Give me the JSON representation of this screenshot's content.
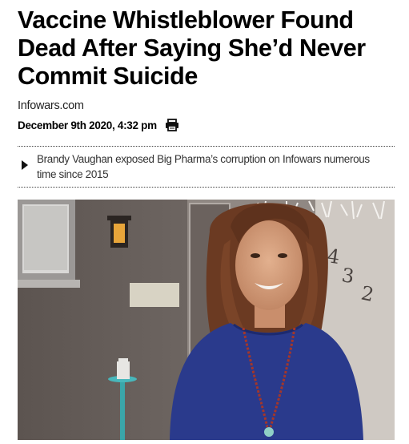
{
  "article": {
    "headline": "Vaccine Whistleblower Found Dead After Saying She’d Never Commit Suicide",
    "source": "Infowars.com",
    "date": "December 9th 2020, 4:32 pm",
    "summary": "Brandy Vaughan exposed Big Pharma’s corruption on Infowars numerous time since 2015",
    "print_icon": "printer-icon",
    "summary_icon": "triangle-right-icon"
  },
  "photo": {
    "wall_numbers": [
      "4",
      "3",
      "2"
    ],
    "colors": {
      "wall": "#6d6561",
      "top": "#8d8988",
      "shirt": "#2a3a8c",
      "hair": "#6b3a22",
      "skin": "#d9a07e"
    }
  }
}
